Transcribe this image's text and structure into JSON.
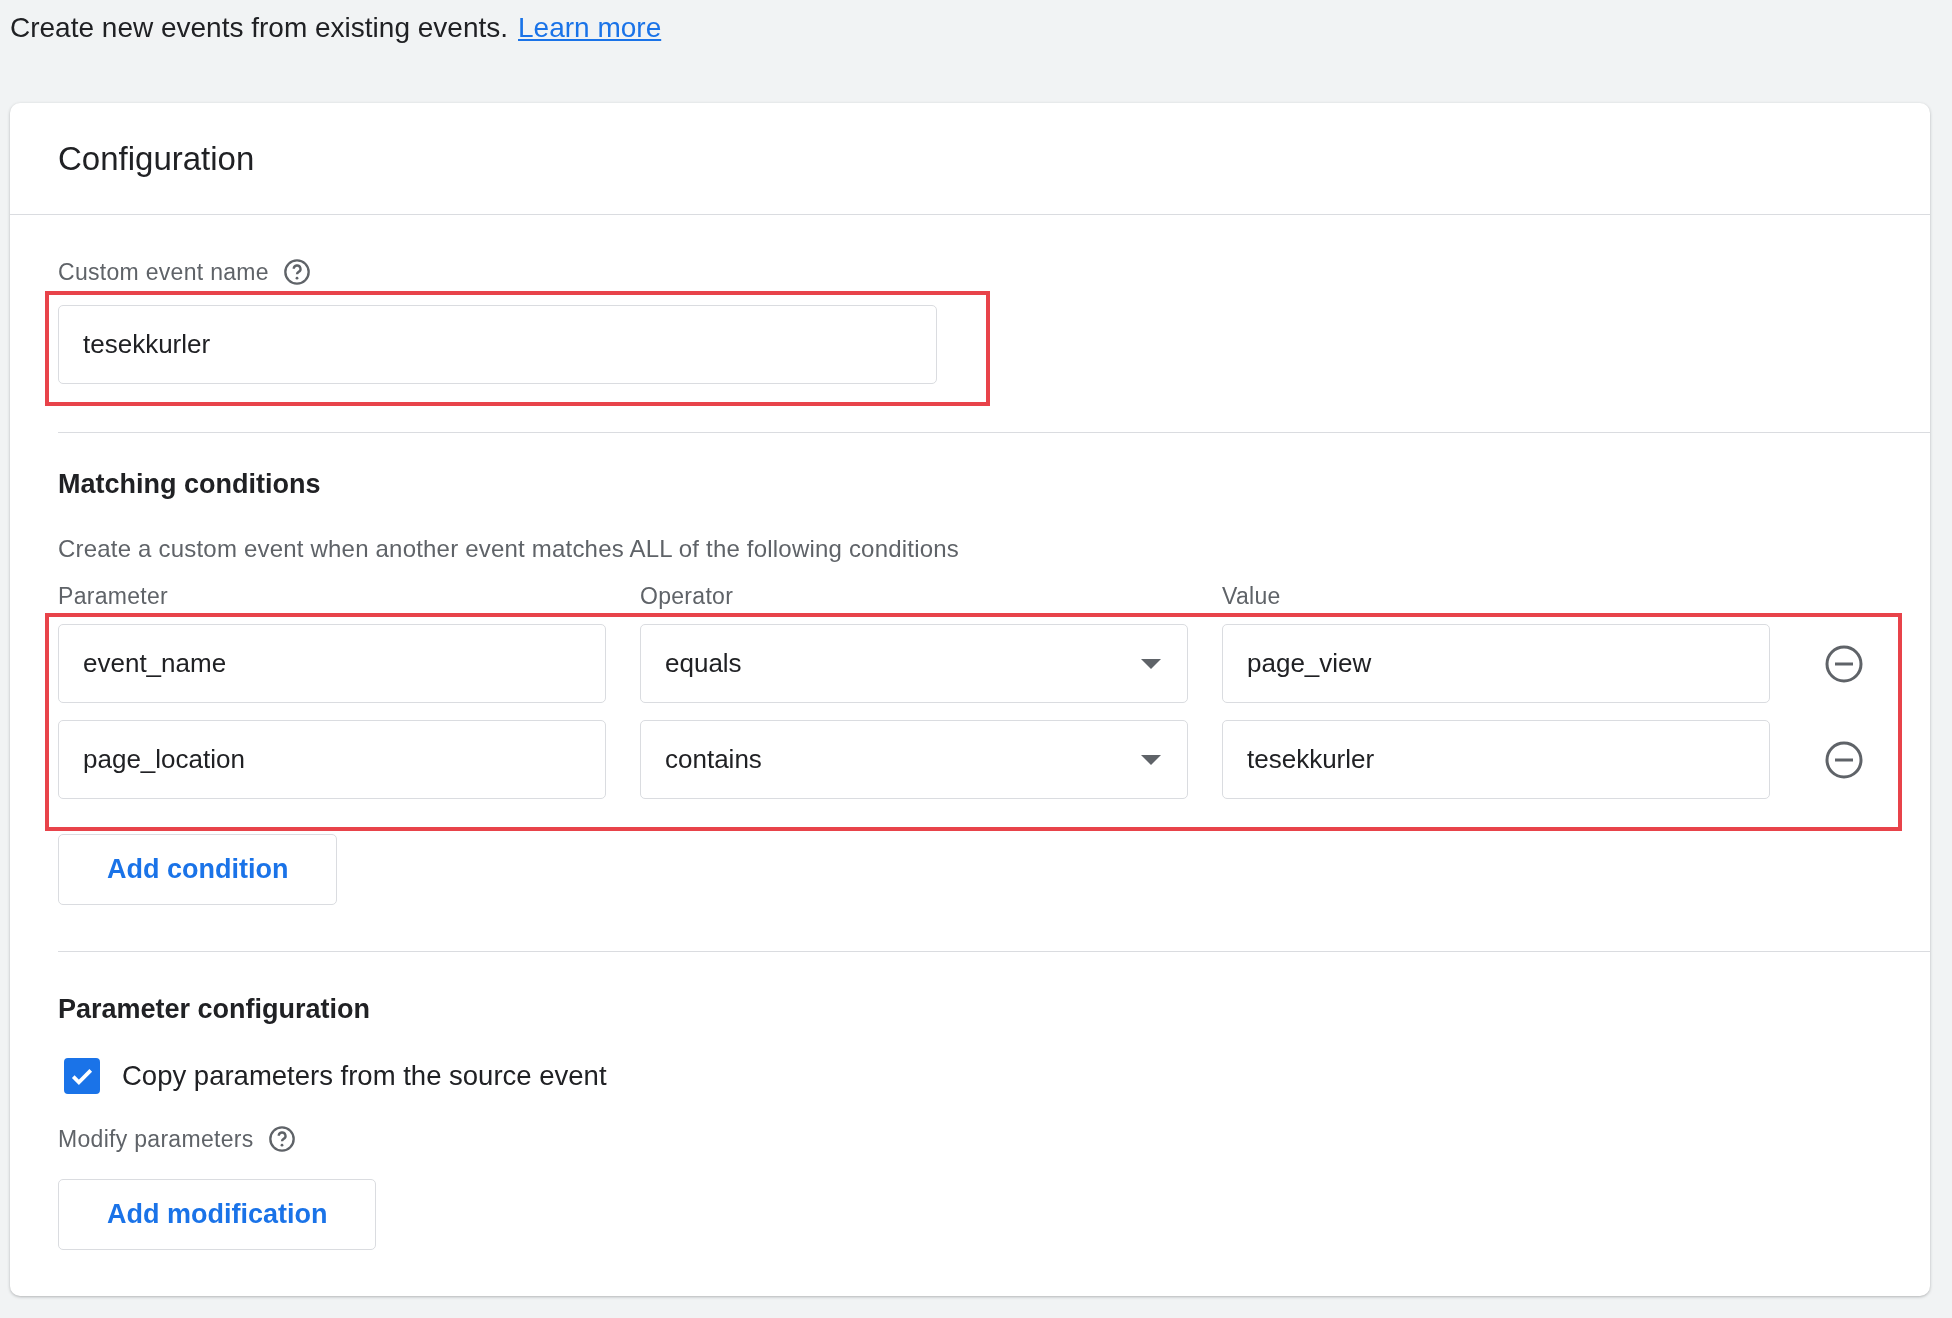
{
  "intro": {
    "text": "Create new events from existing events.",
    "link": "Learn more"
  },
  "card": {
    "title": "Configuration"
  },
  "custom_event_name": {
    "label": "Custom event name",
    "value": "tesekkurler"
  },
  "matching_conditions": {
    "heading": "Matching conditions",
    "description": "Create a custom event when another event matches ALL of the following conditions",
    "columns": [
      "Parameter",
      "Operator",
      "Value"
    ],
    "conditions": [
      {
        "parameter": "event_name",
        "operator": "equals",
        "value": "page_view"
      },
      {
        "parameter": "page_location",
        "operator": "contains",
        "value": "tesekkurler"
      }
    ],
    "add_button": "Add condition"
  },
  "parameter_configuration": {
    "heading": "Parameter configuration",
    "copy_parameters": {
      "label": "Copy parameters from the source event",
      "checked": true
    },
    "modify_label": "Modify parameters",
    "add_button": "Add modification"
  }
}
